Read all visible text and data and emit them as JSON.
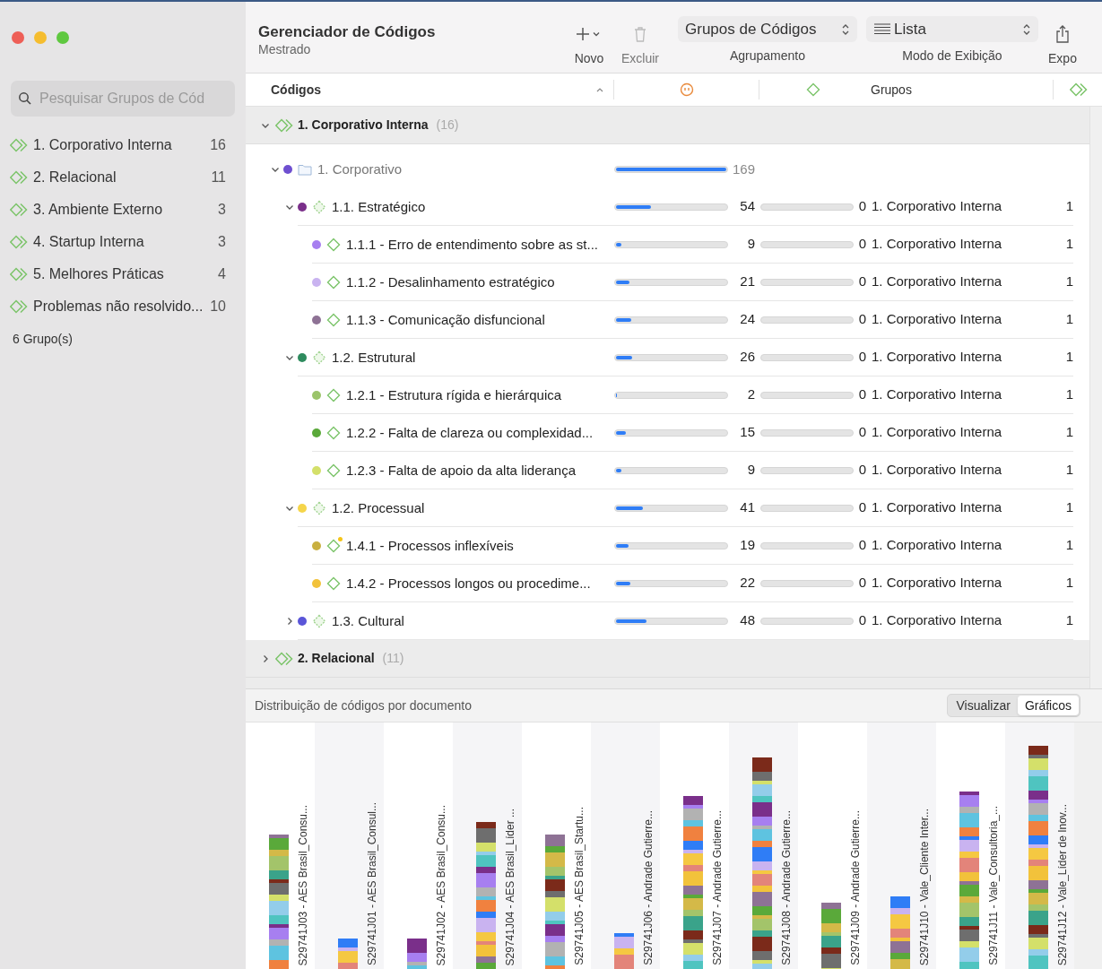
{
  "sidebar": {
    "search": {
      "placeholder": "Pesquisar Grupos de Cód"
    },
    "groups": [
      {
        "label": "1. Corporativo Interna",
        "count": "16"
      },
      {
        "label": "2. Relacional",
        "count": "11"
      },
      {
        "label": "3. Ambiente Externo",
        "count": "3"
      },
      {
        "label": "4. Startup Interna",
        "count": "3"
      },
      {
        "label": "5. Melhores Práticas",
        "count": "4"
      },
      {
        "label": "Problemas não resolvido...",
        "count": "10"
      }
    ],
    "footer": "6 Grupo(s)"
  },
  "header": {
    "title": "Gerenciador de Códigos",
    "subtitle": "Mestrado"
  },
  "toolbar": {
    "new_label": "Novo",
    "delete_label": "Excluir",
    "grouping": {
      "value": "Grupos de Códigos",
      "label": "Agrupamento"
    },
    "view_mode": {
      "value": "Lista",
      "label": "Modo de Exibição"
    },
    "export_label": "Expo"
  },
  "table": {
    "columns": [
      "Códigos",
      "Grupos"
    ],
    "groups": [
      {
        "label": "1. Corporativo Interna",
        "count": "(16)",
        "expanded": true,
        "rows": [
          {
            "kind": "folder",
            "name": "1. Corporativo",
            "color": "#6e4fd0",
            "expanded": true,
            "frequency": {
              "level": 1,
              "reading": "169"
            },
            "children": [
              {
                "kind": "category",
                "name": "1.1. Estratégico",
                "color": "#7a2f8a",
                "expanded": true,
                "memo": false,
                "frequency": {
                  "level": 0.32,
                  "reading": "54"
                },
                "weight": {
                  "level": 0,
                  "reading": "0"
                },
                "group": "1. Corporativo Interna",
                "group_count": "1",
                "children": [
                  {
                    "kind": "code",
                    "name": "1.1.1 - Erro de entendimento sobre as st...",
                    "color": "#a77ff0",
                    "memo": false,
                    "frequency": {
                      "level": 0.05,
                      "reading": "9"
                    },
                    "weight": {
                      "level": 0,
                      "reading": "0"
                    },
                    "group": "1. Corporativo Interna",
                    "group_count": "1"
                  },
                  {
                    "kind": "code",
                    "name": "1.1.2 - Desalinhamento estratégico",
                    "color": "#c9b3f0",
                    "memo": false,
                    "frequency": {
                      "level": 0.12,
                      "reading": "21"
                    },
                    "weight": {
                      "level": 0,
                      "reading": "0"
                    },
                    "group": "1. Corporativo Interna",
                    "group_count": "1"
                  },
                  {
                    "kind": "code",
                    "name": "1.1.3 - Comunicação disfuncional",
                    "color": "#8e7295",
                    "memo": false,
                    "frequency": {
                      "level": 0.14,
                      "reading": "24"
                    },
                    "weight": {
                      "level": 0,
                      "reading": "0"
                    },
                    "group": "1. Corporativo Interna",
                    "group_count": "1"
                  }
                ]
              },
              {
                "kind": "category",
                "name": "1.2. Estrutural",
                "color": "#2e8b5e",
                "expanded": true,
                "memo": false,
                "frequency": {
                  "level": 0.15,
                  "reading": "26"
                },
                "weight": {
                  "level": 0,
                  "reading": "0"
                },
                "group": "1. Corporativo Interna",
                "group_count": "1",
                "children": [
                  {
                    "kind": "code",
                    "name": "1.2.1 - Estrutura rígida e hierárquica",
                    "color": "#9bc46a",
                    "memo": false,
                    "frequency": {
                      "level": 0.01,
                      "reading": "2"
                    },
                    "weight": {
                      "level": 0,
                      "reading": "0"
                    },
                    "group": "1. Corporativo Interna",
                    "group_count": "1"
                  },
                  {
                    "kind": "code",
                    "name": "1.2.2 - Falta de clareza ou complexidad...",
                    "color": "#5aa93a",
                    "memo": false,
                    "frequency": {
                      "level": 0.09,
                      "reading": "15"
                    },
                    "weight": {
                      "level": 0,
                      "reading": "0"
                    },
                    "group": "1. Corporativo Interna",
                    "group_count": "1"
                  },
                  {
                    "kind": "code",
                    "name": "1.2.3 - Falta de apoio da alta liderança",
                    "color": "#d4e06a",
                    "memo": false,
                    "frequency": {
                      "level": 0.05,
                      "reading": "9"
                    },
                    "weight": {
                      "level": 0,
                      "reading": "0"
                    },
                    "group": "1. Corporativo Interna",
                    "group_count": "1"
                  }
                ]
              },
              {
                "kind": "category",
                "name": "1.2. Processual",
                "color": "#f5d54a",
                "expanded": true,
                "memo": false,
                "frequency": {
                  "level": 0.24,
                  "reading": "41"
                },
                "weight": {
                  "level": 0,
                  "reading": "0"
                },
                "group": "1. Corporativo Interna",
                "group_count": "1",
                "children": [
                  {
                    "kind": "code",
                    "name": "1.4.1 - Processos inflexíveis",
                    "color": "#c9b040",
                    "memo": true,
                    "frequency": {
                      "level": 0.11,
                      "reading": "19"
                    },
                    "weight": {
                      "level": 0,
                      "reading": "0"
                    },
                    "group": "1. Corporativo Interna",
                    "group_count": "1"
                  },
                  {
                    "kind": "code",
                    "name": "1.4.2 - Processos longos ou procedime...",
                    "color": "#f2c23b",
                    "memo": false,
                    "frequency": {
                      "level": 0.13,
                      "reading": "22"
                    },
                    "weight": {
                      "level": 0,
                      "reading": "0"
                    },
                    "group": "1. Corporativo Interna",
                    "group_count": "1"
                  }
                ]
              },
              {
                "kind": "category",
                "name": "1.3. Cultural",
                "color": "#5a55d8",
                "expanded": false,
                "memo": false,
                "frequency": {
                  "level": 0.28,
                  "reading": "48"
                },
                "weight": {
                  "level": 0,
                  "reading": "0"
                },
                "group": "1. Corporativo Interna",
                "group_count": "1"
              }
            ]
          }
        ]
      },
      {
        "label": "2. Relacional",
        "count": "(11)",
        "expanded": false
      }
    ]
  },
  "chart_panel": {
    "title": "Distribuição de códigos por documento",
    "view_tabs": [
      {
        "label": "Visualizar",
        "selected": false
      },
      {
        "label": "Gráficos",
        "selected": true
      }
    ],
    "documents": [
      "S29741J03 - AES Brasil_Consu...",
      "S29741J01 - AES Brasil_Consul...",
      "S29741J02 - AES Brasil_Consu...",
      "S29741J04 - AES Brasil_Líder ...",
      "S29741J05 - AES Brasil_Startu...",
      "S29741J06 - Andrade Gutierre...",
      "S29741J07 - Andrade Gutierre...",
      "S29741J08 - Andrade Gutierre...",
      "S29741J09 - Andrade Gutierre...",
      "S29741J10 - Vale_Cliente Inter...",
      "S29741J11 - Vale_Consultoria_...",
      "S29741J12 - Vale_Líder de Inov..."
    ]
  }
}
